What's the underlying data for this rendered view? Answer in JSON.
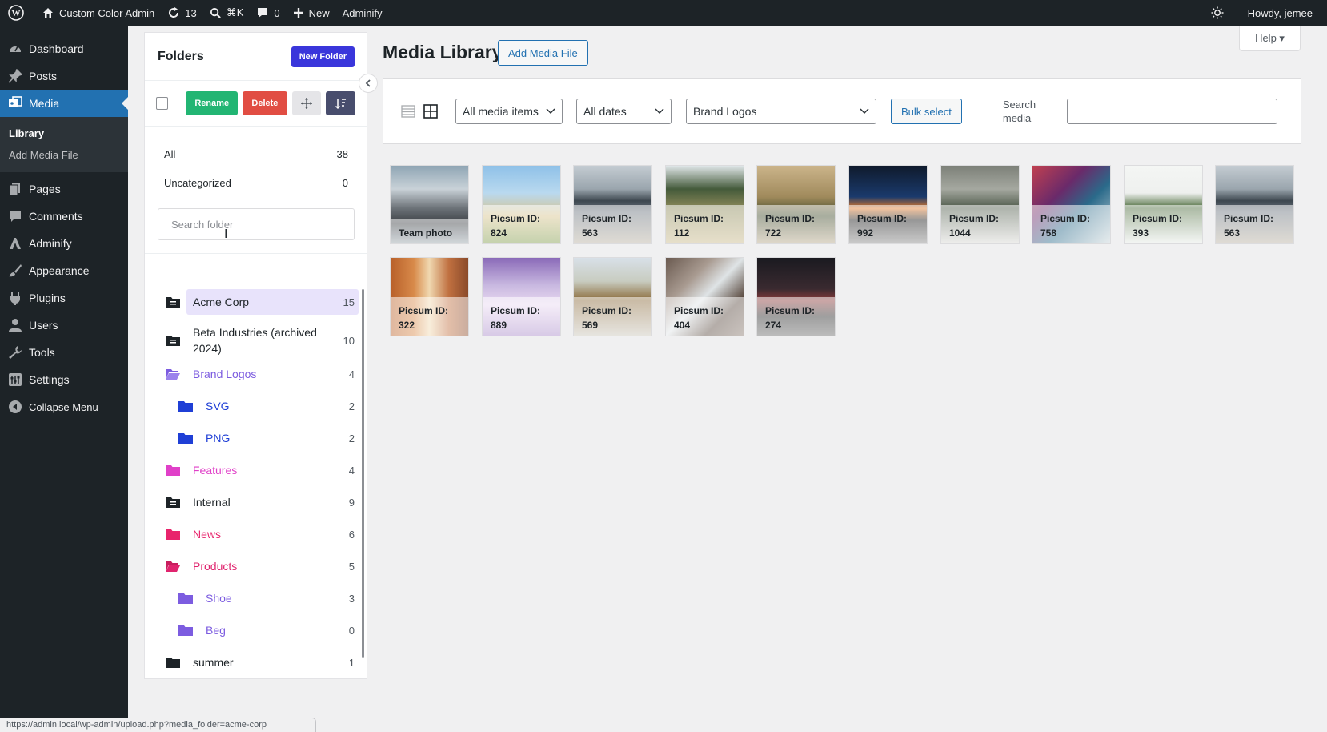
{
  "adminbar": {
    "site_name": "Custom Color Admin",
    "updates_count": "13",
    "search_shortcut": "⌘K",
    "comments_count": "0",
    "new_label": "New",
    "adminify_label": "Adminify",
    "howdy": "Howdy, jemee"
  },
  "sidebar": {
    "items": [
      {
        "label": "Dashboard",
        "icon": "dashboard-icon"
      },
      {
        "label": "Posts",
        "icon": "pin-icon"
      },
      {
        "label": "Media",
        "icon": "media-icon"
      },
      {
        "label": "Pages",
        "icon": "pages-icon"
      },
      {
        "label": "Comments",
        "icon": "comment-icon"
      },
      {
        "label": "Adminify",
        "icon": "adminify-icon"
      },
      {
        "label": "Appearance",
        "icon": "brush-icon"
      },
      {
        "label": "Plugins",
        "icon": "plugin-icon"
      },
      {
        "label": "Users",
        "icon": "users-icon"
      },
      {
        "label": "Tools",
        "icon": "wrench-icon"
      },
      {
        "label": "Settings",
        "icon": "settings-icon"
      },
      {
        "label": "Collapse Menu",
        "icon": "collapse-icon"
      }
    ],
    "media_submenu": [
      "Library",
      "Add Media File"
    ]
  },
  "folders": {
    "title": "Folders",
    "new_folder": "New Folder",
    "rename": "Rename",
    "delete": "Delete",
    "all_label": "All",
    "all_count": "38",
    "uncategorized_label": "Uncategorized",
    "uncategorized_count": "0",
    "search_placeholder": "Search folder",
    "tree": [
      {
        "name": "Acme Corp",
        "count": "15",
        "color": "#1d2327"
      },
      {
        "name": "Beta Industries (archived 2024)",
        "count": "10",
        "color": "#1d2327"
      },
      {
        "name": "Brand Logos",
        "count": "4",
        "color": "#7c5ce0"
      },
      {
        "name": "SVG",
        "count": "2",
        "color": "#1f3fd6"
      },
      {
        "name": "PNG",
        "count": "2",
        "color": "#1f3fd6"
      },
      {
        "name": "Features",
        "count": "4",
        "color": "#e040c8"
      },
      {
        "name": "Internal",
        "count": "9",
        "color": "#1d2327"
      },
      {
        "name": "News",
        "count": "6",
        "color": "#e8246c"
      },
      {
        "name": "Products",
        "count": "5",
        "color": "#e0246e"
      },
      {
        "name": "Shoe",
        "count": "3",
        "color": "#7c5ce0"
      },
      {
        "name": "Beg",
        "count": "0",
        "color": "#7c5ce0"
      },
      {
        "name": "summer",
        "count": "1",
        "color": "#1d2327"
      }
    ]
  },
  "main": {
    "title": "Media Library",
    "add_media": "Add Media File",
    "help": "Help ▾",
    "filter_type": "All media items",
    "filter_date": "All dates",
    "filter_folder": "Brand Logos",
    "bulk_select": "Bulk select",
    "search_label": "Search media",
    "tiles": [
      {
        "line1": "Team photo",
        "line2": ""
      },
      {
        "line1": "Picsum ID:",
        "line2": "824"
      },
      {
        "line1": "Picsum ID:",
        "line2": "563"
      },
      {
        "line1": "Picsum ID:",
        "line2": "112"
      },
      {
        "line1": "Picsum ID:",
        "line2": "722"
      },
      {
        "line1": "Picsum ID:",
        "line2": "992"
      },
      {
        "line1": "Picsum ID:",
        "line2": "1044"
      },
      {
        "line1": "Picsum ID:",
        "line2": "758"
      },
      {
        "line1": "Picsum ID:",
        "line2": "393"
      },
      {
        "line1": "Picsum ID:",
        "line2": "563"
      },
      {
        "line1": "Picsum ID:",
        "line2": "322"
      },
      {
        "line1": "Picsum ID:",
        "line2": "889"
      },
      {
        "line1": "Picsum ID:",
        "line2": "569"
      },
      {
        "line1": "Picsum ID:",
        "line2": "404"
      },
      {
        "line1": "Picsum ID:",
        "line2": "274"
      }
    ]
  },
  "status_url": "https://admin.local/wp-admin/upload.php?media_folder=acme-corp",
  "colors": {
    "admin_dark": "#1d2327",
    "wp_blue": "#2271b1",
    "new_folder_blue": "#3a36db",
    "rename_green": "#22b573",
    "delete_red": "#e14d43"
  }
}
